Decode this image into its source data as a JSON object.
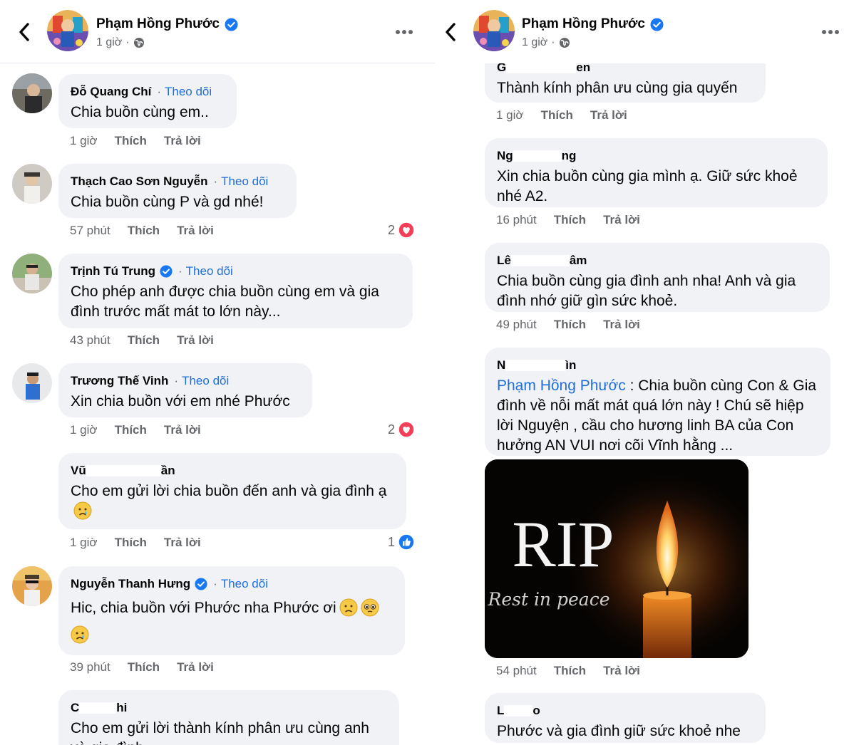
{
  "left": {
    "header": {
      "name": "Phạm Hồng Phước",
      "time": "1 giờ",
      "time_sep": "·"
    },
    "comments": [
      {
        "name": "Đỗ Quang Chí",
        "follow": "Theo dõi",
        "text": "Chia buồn cùng em..",
        "time": "1 giờ",
        "like": "Thích",
        "reply": "Trả lời"
      },
      {
        "name": "Thạch Cao Sơn Nguyễn",
        "follow": "Theo dõi",
        "text": "Chia buồn cùng P và gd nhé!",
        "time": "57 phút",
        "like": "Thích",
        "reply": "Trả lời",
        "reaction_count": "2"
      },
      {
        "name": "Trịnh Tú Trung",
        "follow": "Theo dõi",
        "text": "Cho phép anh được chia buồn cùng em và gia đình trước mất mát to lớn này...",
        "time": "43 phút",
        "like": "Thích",
        "reply": "Trả lời"
      },
      {
        "name": "Trương Thế Vinh",
        "follow": "Theo dõi",
        "text": "Xin chia buồn với em nhé Phước",
        "time": "1 giờ",
        "like": "Thích",
        "reply": "Trả lời",
        "reaction_count": "2"
      },
      {
        "name_a": "Vũ",
        "name_b": "ần",
        "text": "Cho em gửi lời chia buồn đến anh và gia đình ạ",
        "time": "1 giờ",
        "like": "Thích",
        "reply": "Trả lời",
        "reaction_count": "1"
      },
      {
        "name": "Nguyễn Thanh Hưng",
        "follow": "Theo dõi",
        "text": "Hic, chia buồn với Phước nha Phước ơi",
        "time": "39 phút",
        "like": "Thích",
        "reply": "Trả lời"
      },
      {
        "name_a": "C",
        "name_b": "hi",
        "text": "Cho em gửi lời thành kính phân ưu cùng anh và gia đình"
      }
    ]
  },
  "right": {
    "header": {
      "name": "Phạm Hồng Phước",
      "time": "1 giờ",
      "time_sep": "·"
    },
    "comments": [
      {
        "name_a": "G",
        "name_b": "en",
        "text": "Thành kính phân ưu cùng gia quyến",
        "time": "1 giờ",
        "like": "Thích",
        "reply": "Trả lời"
      },
      {
        "name_a": "Ng",
        "name_b": "ng",
        "text": "Xin chia buồn cùng gia mình ạ. Giữ sức khoẻ nhé A2.",
        "time": "16 phút",
        "like": "Thích",
        "reply": "Trả lời"
      },
      {
        "name_a": "Lê",
        "name_b": "âm",
        "text": "Chia buồn cùng gia đình anh nha! Anh và gia đình nhớ giữ gìn sức khoẻ.",
        "time": "49 phút",
        "like": "Thích",
        "reply": "Trả lời"
      },
      {
        "name_a": "N",
        "name_b": "ìn",
        "mention": "Phạm Hồng Phước",
        "text": " : Chia buồn cùng Con & Gia đình về nỗi mất mát quá lớn này ! Chú sẽ hiệp lời Nguyện , cầu cho hương linh BA của Con hưởng AN VUI nơi cõi Vĩnh hằng ...",
        "image_title": "RIP",
        "image_subtitle": "Rest in peace",
        "time": "54 phút",
        "like": "Thích",
        "reply": "Trả lời"
      },
      {
        "name_a": "L",
        "name_b": "o",
        "text": "Phước và gia đình giữ sức khoẻ nhe"
      }
    ]
  },
  "colors": {
    "link": "#216fdb",
    "bubble": "#f0f2f5",
    "meta": "#65676b",
    "love": "#f33e58",
    "like": "#1877f2"
  },
  "icons": [
    "back-icon",
    "verified-icon",
    "globe-icon",
    "more-icon",
    "heart-icon",
    "like-icon",
    "sad-emoji-icon",
    "pleading-emoji-icon",
    "crying-emoji-icon"
  ]
}
